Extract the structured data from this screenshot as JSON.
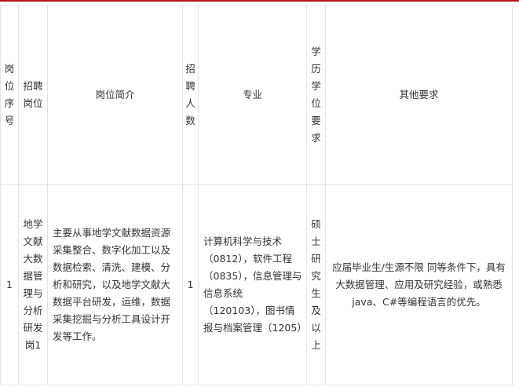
{
  "table": {
    "headers": {
      "seq": "岗位序号",
      "post": "招聘岗位",
      "intro": "岗位简介",
      "count": "招聘人数",
      "major": "专业",
      "edu": "学历学位要求",
      "other": "其他要求"
    },
    "rows": [
      {
        "seq": "1",
        "post": "地学文献大数据管理与分析研发岗1",
        "intro": "主要从事地学文献数据资源采集整合、数字化加工以及数据检索、清洗、建模、分析和研究，以及地学文献大数据平台研发，运维，数据采集挖掘与分析工具设计开发等工作。",
        "count": "1",
        "major": "计算机科学与技术（0812），软件工程（0835），信息管理与信息系统（120103），图书情报与档案管理（1205）",
        "edu": "硕士研究生及以上",
        "other": "应届毕业生/生源不限 同等条件下，具有大数据管理、应用及研究经验，或熟悉java、C#等编程语言的优先。"
      }
    ]
  }
}
